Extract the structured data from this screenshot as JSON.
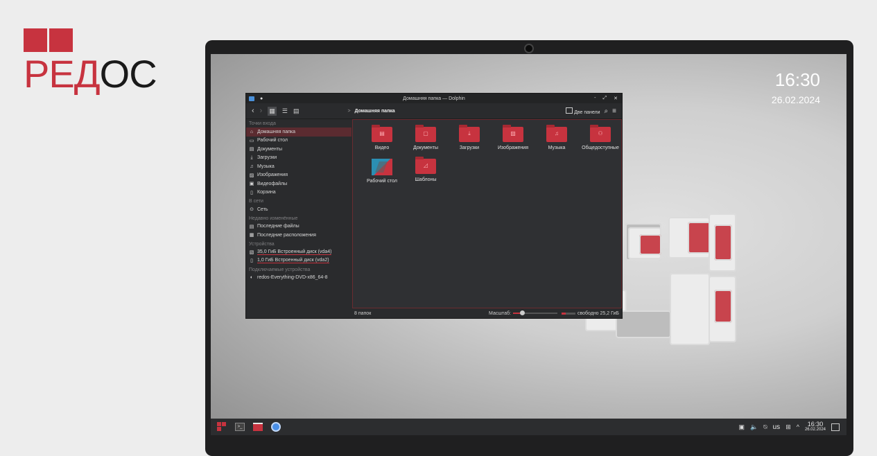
{
  "brand": {
    "name_first": "Р",
    "name_second": "ЕД",
    "name_third": "ОС",
    "color": "#c7333f"
  },
  "desktop": {
    "time": "16:30",
    "date": "26.02.2024"
  },
  "window": {
    "title": "Домашняя папка — Dolphin",
    "controls": {
      "minimize": "-",
      "maximize": "⤢",
      "close": "✕"
    },
    "toolbar": {
      "back": "‹",
      "forward": "›",
      "breadcrumb_arrow": ">",
      "breadcrumb": "Домашняя папка",
      "split_label": "Две панели",
      "search_icon": "⌕",
      "menu_icon": "≡"
    },
    "sidebar": {
      "places_header": "Точки входа",
      "places": [
        {
          "icon": "home-icon",
          "glyph": "⌂",
          "label": "Домашняя папка"
        },
        {
          "icon": "desktop-icon",
          "glyph": "▭",
          "label": "Рабочий стол"
        },
        {
          "icon": "documents-icon",
          "glyph": "▤",
          "label": "Документы"
        },
        {
          "icon": "download-icon",
          "glyph": "⤓",
          "label": "Загрузки"
        },
        {
          "icon": "music-icon",
          "glyph": "♫",
          "label": "Музыка"
        },
        {
          "icon": "images-icon",
          "glyph": "▨",
          "label": "Изображения"
        },
        {
          "icon": "video-icon",
          "glyph": "▣",
          "label": "Видеофайлы"
        },
        {
          "icon": "trash-icon",
          "glyph": "▯",
          "label": "Корзина"
        }
      ],
      "network_header": "В сети",
      "network": [
        {
          "icon": "network-icon",
          "glyph": "⊙",
          "label": "Сеть"
        }
      ],
      "recent_header": "Недавно изменённые",
      "recent": [
        {
          "icon": "recent-files-icon",
          "glyph": "▤",
          "label": "Последние файлы"
        },
        {
          "icon": "recent-locations-icon",
          "glyph": "▦",
          "label": "Последние расположения"
        }
      ],
      "devices_header": "Устройства",
      "devices": [
        {
          "icon": "disk-icon",
          "glyph": "▧",
          "label": "35,0 ГиБ Встроенный диск (vda4)"
        },
        {
          "icon": "disk-icon",
          "glyph": "▯",
          "label": "1,0 ГиБ Встроенный диск (vda2)"
        }
      ],
      "removable_header": "Подключаемые устройства",
      "removable": [
        {
          "icon": "dvd-icon",
          "glyph": "◐",
          "label": "redos-Everything-DVD-x86_64-8"
        }
      ]
    },
    "items": [
      {
        "label": "Видео",
        "glyph": "▤"
      },
      {
        "label": "Документы",
        "glyph": "▢"
      },
      {
        "label": "Загрузки",
        "glyph": "⤓"
      },
      {
        "label": "Изображения",
        "glyph": "▨"
      },
      {
        "label": "Музыка",
        "glyph": "♫"
      },
      {
        "label": "Общедоступные",
        "glyph": "⚇"
      },
      {
        "label": "Рабочий стол",
        "glyph": ""
      },
      {
        "label": "Шаблоны",
        "glyph": "◿"
      }
    ],
    "status": {
      "count": "8 папок",
      "zoom_label": "Масштаб:",
      "zoom_level": 0.2,
      "free": "свободно 25,2 ГиБ",
      "used_fraction": 0.28
    }
  },
  "taskbar": {
    "terminal_glyph": ">_",
    "tray": {
      "clipboard": "▣",
      "volume": "🔈",
      "battery": "⍉",
      "layout": "us",
      "network": "⊞",
      "expand": "^",
      "time": "16:30",
      "date": "26.02.2024"
    }
  }
}
